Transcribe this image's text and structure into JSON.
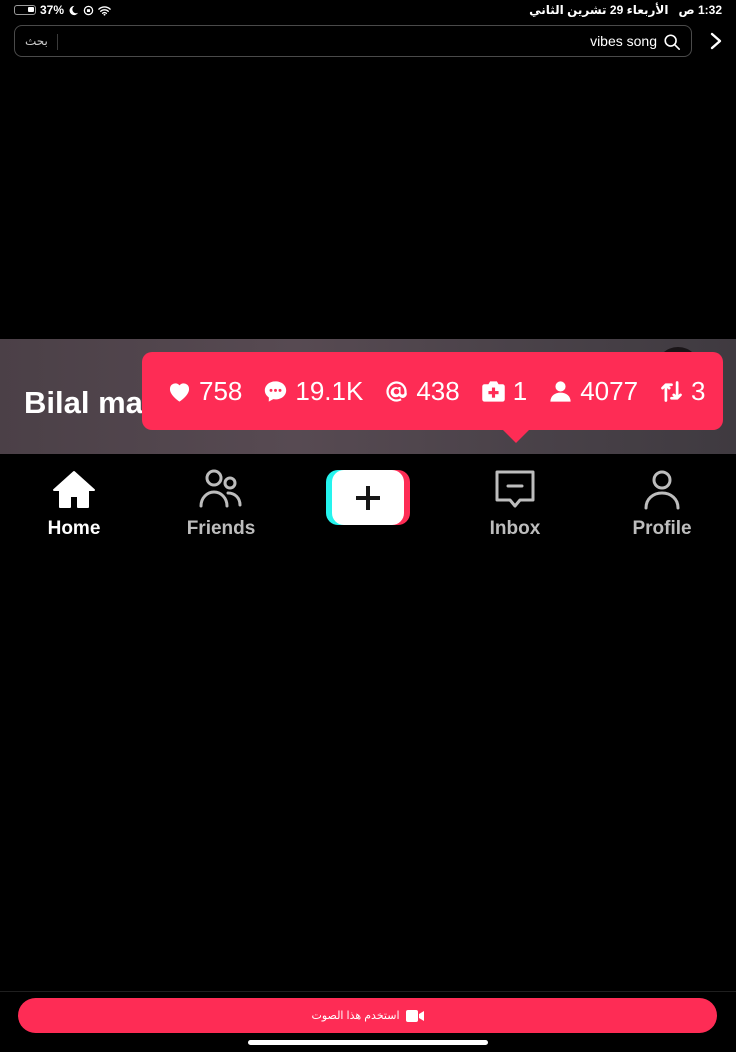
{
  "status_bar": {
    "battery_percent": "37%",
    "time": "1:32",
    "am_pm": "ص",
    "date": "الأربعاء 29 تشرين الثاني",
    "icons": [
      "battery-icon",
      "moon-icon",
      "orientation-lock-icon",
      "wifi-icon"
    ]
  },
  "search": {
    "query": "vibes song",
    "submit_label": "بحث",
    "icons": [
      "search-icon",
      "chevron-right-icon"
    ]
  },
  "video": {
    "creator_name_partial": "Bilal ma"
  },
  "stats": [
    {
      "icon": "heart-icon",
      "value": "758"
    },
    {
      "icon": "comment-icon",
      "value": "19.1K"
    },
    {
      "icon": "mention-icon",
      "value": "438"
    },
    {
      "icon": "add-box-icon",
      "value": "1"
    },
    {
      "icon": "person-icon",
      "value": "4077"
    },
    {
      "icon": "repost-icon",
      "value": "3"
    }
  ],
  "nav": {
    "home": "Home",
    "friends": "Friends",
    "create": "+",
    "inbox": "Inbox",
    "profile": "Profile"
  },
  "bottom": {
    "use_sound_label": "استخدم هذا الصوت"
  },
  "colors": {
    "accent": "#fe2c55",
    "accent_secondary": "#25f4ee",
    "background": "#000000"
  }
}
